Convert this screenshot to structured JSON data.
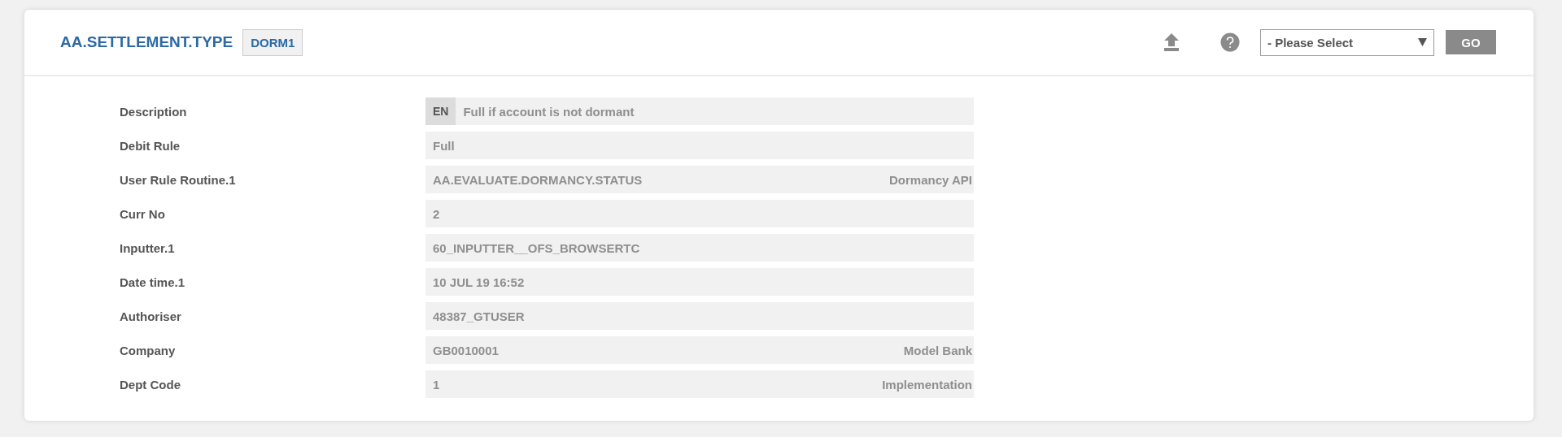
{
  "header": {
    "title": "AA.SETTLEMENT.TYPE",
    "record_id": "DORM1",
    "select": {
      "value": "- Please Select"
    },
    "go_button": "GO"
  },
  "fields": [
    {
      "label": "Description",
      "language": "EN",
      "value": "Full if account is not dormant"
    },
    {
      "label": "Debit Rule",
      "value": "Full"
    },
    {
      "label": "User Rule Routine.1",
      "value": "AA.EVALUATE.DORMANCY.STATUS",
      "note": "Dormancy API"
    },
    {
      "label": "Curr No",
      "value": "2"
    },
    {
      "label": "Inputter.1",
      "value": "60_INPUTTER__OFS_BROWSERTC"
    },
    {
      "label": "Date time.1",
      "value": "10 JUL 19 16:52"
    },
    {
      "label": "Authoriser",
      "value": "48387_GTUSER"
    },
    {
      "label": "Company",
      "value": "GB0010001",
      "note": "Model Bank"
    },
    {
      "label": "Dept Code",
      "value": "1",
      "note": "Implementation"
    }
  ]
}
